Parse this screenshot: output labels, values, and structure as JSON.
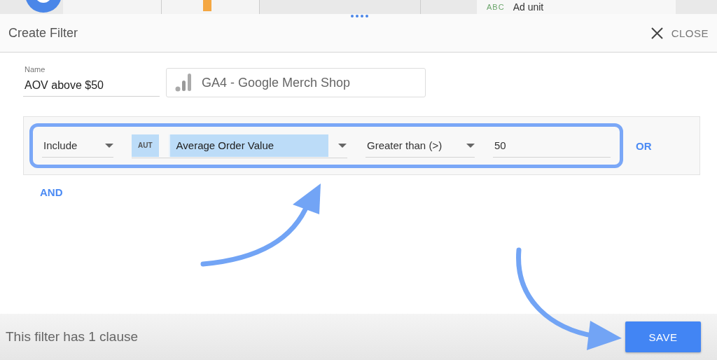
{
  "background_report": {
    "type_badge": "ABC",
    "label": "Ad unit"
  },
  "dialog": {
    "title": "Create Filter",
    "close_label": "CLOSE",
    "name_field": {
      "label": "Name",
      "value": "AOV above $50"
    },
    "data_source": "GA4 - Google Merch Shop",
    "clauses": [
      {
        "highlighted": true,
        "mode": "Include",
        "field_type": "AUT",
        "field": "Average Order Value",
        "field_selected": true,
        "operator": "Greater than (>)",
        "value": "50",
        "or_label": "OR"
      }
    ],
    "and_label": "AND",
    "status": "This filter has 1 clause",
    "save_label": "SAVE"
  }
}
